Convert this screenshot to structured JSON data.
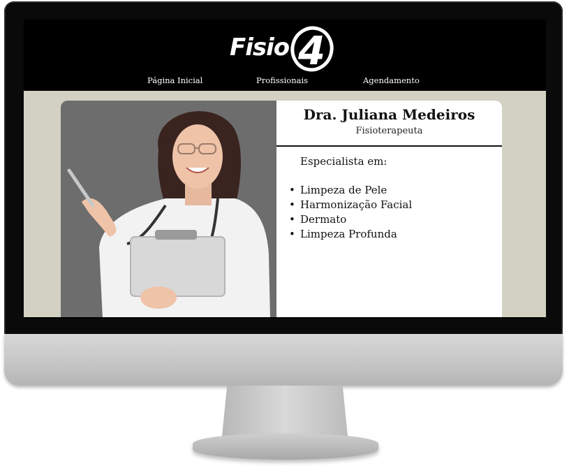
{
  "header": {
    "logo_text": "Fisio",
    "logo_number": "4"
  },
  "nav": {
    "items": [
      {
        "label": "Página Inicial"
      },
      {
        "label": "Profissionais"
      },
      {
        "label": "Agendamento"
      }
    ]
  },
  "profile": {
    "name": "Dra. Juliana Medeiros",
    "role": "Fisioterapeuta",
    "specialties_title": "Especialista em:",
    "specialties": [
      "Limpeza de Pele",
      "Harmonização Facial",
      "Dermato",
      "Limpeza Profunda"
    ]
  },
  "colors": {
    "header_bg": "#000000",
    "page_bg": "#d2d1c2",
    "photo_bg": "#6d6d6d"
  }
}
